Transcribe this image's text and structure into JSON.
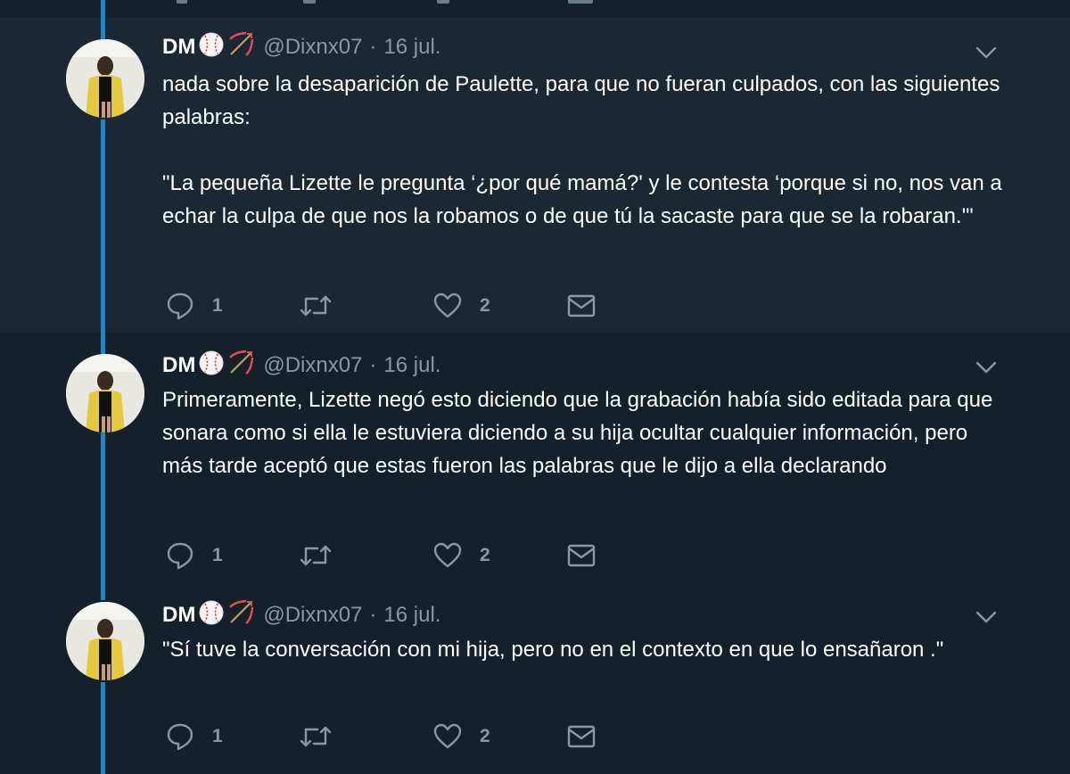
{
  "tweets": [
    {
      "author": "DM",
      "handle": "@Dixnx07",
      "separator": "·",
      "date": "16 jul.",
      "text": "nada sobre la desaparición de Paulette, para que no fueran culpados, con las siguientes palabras:\n\n\"La pequeña Lizette le pregunta ‘¿por qué mamá?' y le contesta ‘porque si no, nos van a echar la culpa de que nos la robamos o de que tú la sacaste para que se la robaran.'\"",
      "replies": "1",
      "likes": "2"
    },
    {
      "author": "DM",
      "handle": "@Dixnx07",
      "separator": "·",
      "date": "16 jul.",
      "text": "Primeramente, Lizette negó esto diciendo que la grabación había sido editada para que sonara como si ella le estuviera diciendo a su hija ocultar cualquier información, pero más tarde aceptó que estas fueron las palabras que le dijo a ella declarando",
      "replies": "1",
      "likes": "2"
    },
    {
      "author": "DM",
      "handle": "@Dixnx07",
      "separator": "·",
      "date": "16 jul.",
      "text": "\"Sí tuve la conversación con mi hija, pero no en el contexto en que lo ensañaron .\"",
      "replies": "1",
      "likes": "2"
    }
  ],
  "icons": {
    "reply": "speech-bubble-icon",
    "retweet": "retweet-arrows-icon",
    "like": "heart-icon",
    "message": "envelope-icon",
    "more": "chevron-down-icon",
    "name_emoji_1": "baseball-emoji",
    "name_emoji_2": "bow-and-arrow-emoji"
  },
  "colors": {
    "background": "#15202b",
    "highlight_background": "#1b2733",
    "thread_line": "#1d85c9",
    "secondary_text": "#8899a6"
  }
}
